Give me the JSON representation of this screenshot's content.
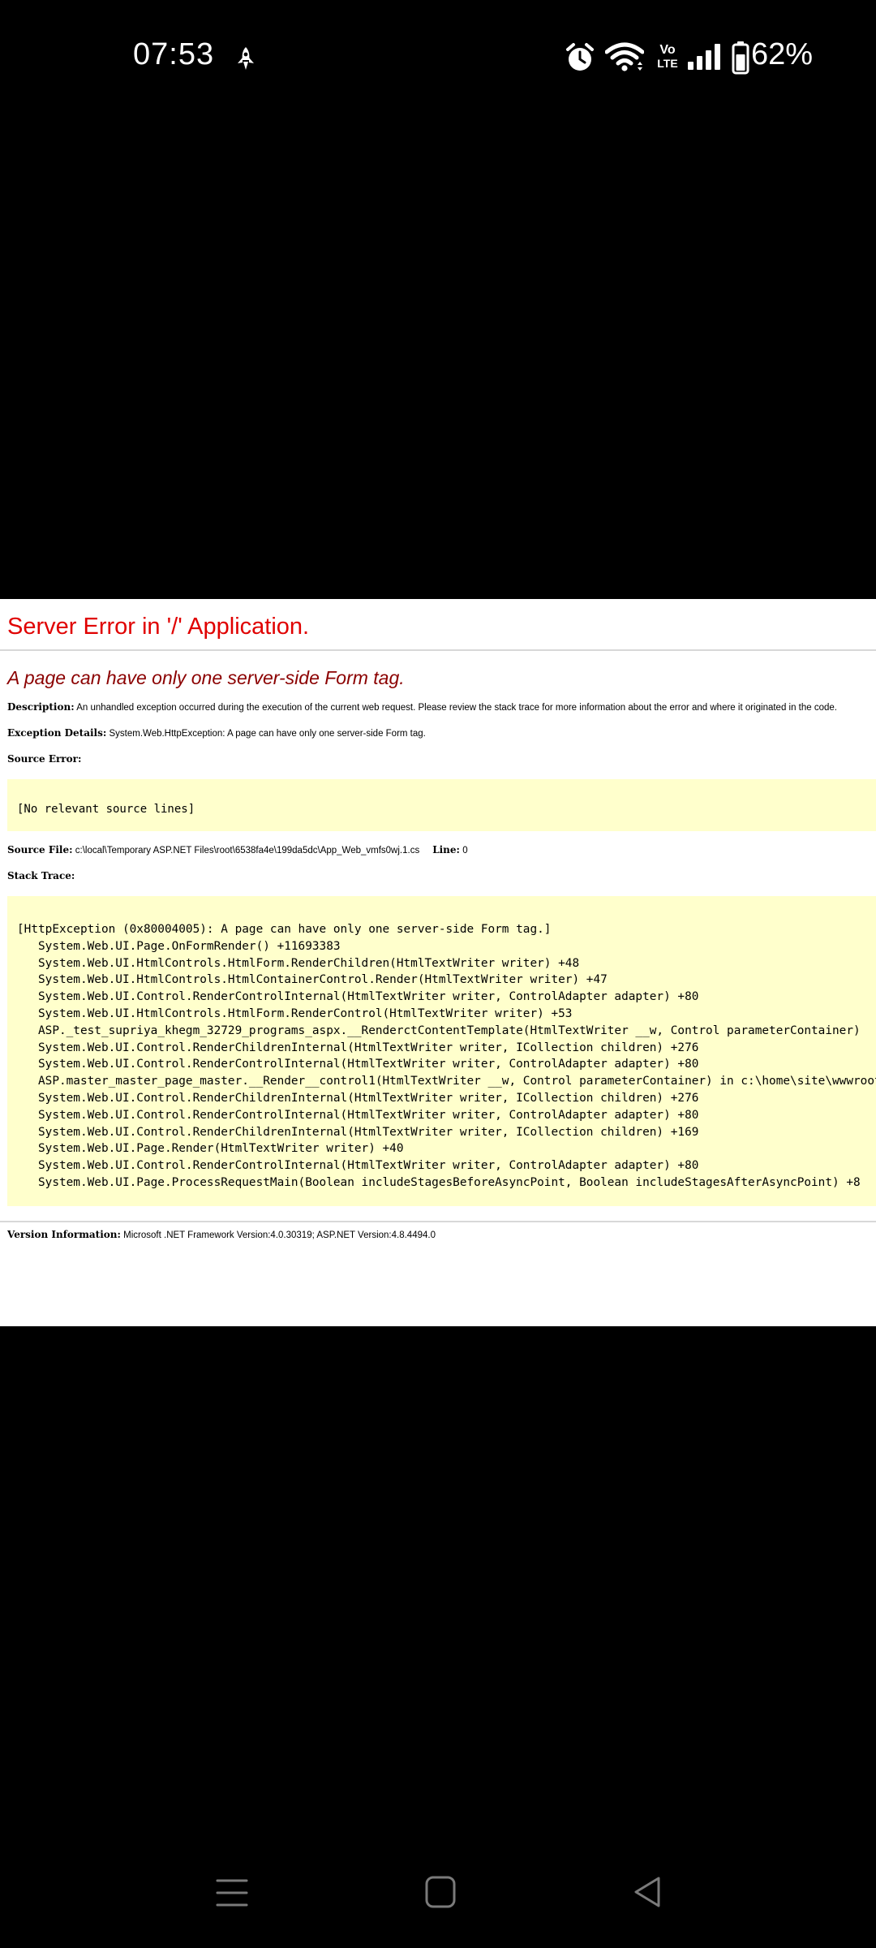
{
  "status_bar": {
    "time": "07:53",
    "battery_percent": "62%",
    "network_label_top": "Vo",
    "network_label_bottom": "LTE",
    "icons": [
      "rocket-notification-icon",
      "alarm-icon",
      "wifi-icon",
      "volte-icon",
      "signal-icon",
      "battery-icon"
    ]
  },
  "error_page": {
    "title": "Server Error in '/' Application.",
    "heading": "A page can have only one server-side Form tag.",
    "description_label": "Description:",
    "description_text": "An unhandled exception occurred during the execution of the current web request. Please review the stack trace for more information about the error and where it originated in the code.",
    "exception_label": "Exception Details:",
    "exception_text": "System.Web.HttpException: A page can have only one server-side Form tag.",
    "source_error_label": "Source Error:",
    "source_error_text": "[No relevant source lines]",
    "source_file_label": "Source File:",
    "source_file_text": "c:\\local\\Temporary ASP.NET Files\\root\\6538fa4e\\199da5dc\\App_Web_vmfs0wj.1.cs",
    "line_label": "Line:",
    "line_value": "0",
    "stack_trace_label": "Stack Trace:",
    "stack_trace": [
      "[HttpException (0x80004005): A page can have only one server-side Form tag.]",
      "   System.Web.UI.Page.OnFormRender() +11693383",
      "   System.Web.UI.HtmlControls.HtmlForm.RenderChildren(HtmlTextWriter writer) +48",
      "   System.Web.UI.HtmlControls.HtmlContainerControl.Render(HtmlTextWriter writer) +47",
      "   System.Web.UI.Control.RenderControlInternal(HtmlTextWriter writer, ControlAdapter adapter) +80",
      "   System.Web.UI.HtmlControls.HtmlForm.RenderControl(HtmlTextWriter writer) +53",
      "   ASP._test_supriya_khegm_32729_programs_aspx.__RenderctContentTemplate(HtmlTextWriter __w, Control parameterContainer)",
      "   System.Web.UI.Control.RenderChildrenInternal(HtmlTextWriter writer, ICollection children) +276",
      "   System.Web.UI.Control.RenderControlInternal(HtmlTextWriter writer, ControlAdapter adapter) +80",
      "   ASP.master_master_page_master.__Render__control1(HtmlTextWriter __w, Control parameterContainer) in c:\\home\\site\\wwwroot",
      "   System.Web.UI.Control.RenderChildrenInternal(HtmlTextWriter writer, ICollection children) +276",
      "   System.Web.UI.Control.RenderControlInternal(HtmlTextWriter writer, ControlAdapter adapter) +80",
      "   System.Web.UI.Control.RenderChildrenInternal(HtmlTextWriter writer, ICollection children) +169",
      "   System.Web.UI.Page.Render(HtmlTextWriter writer) +40",
      "   System.Web.UI.Control.RenderControlInternal(HtmlTextWriter writer, ControlAdapter adapter) +80",
      "   System.Web.UI.Page.ProcessRequestMain(Boolean includeStagesBeforeAsyncPoint, Boolean includeStagesAfterAsyncPoint) +8"
    ],
    "version_label": "Version Information:",
    "version_text": "Microsoft .NET Framework Version:4.0.30319; ASP.NET Version:4.8.4494.0"
  },
  "nav_bar": {
    "buttons": [
      "recents-menu-icon",
      "home-square-icon",
      "back-triangle-icon"
    ]
  },
  "colors": {
    "title_red": "#e00000",
    "heading_maroon": "#8b0000",
    "code_background": "#ffffcc",
    "system_bar": "#000000"
  }
}
